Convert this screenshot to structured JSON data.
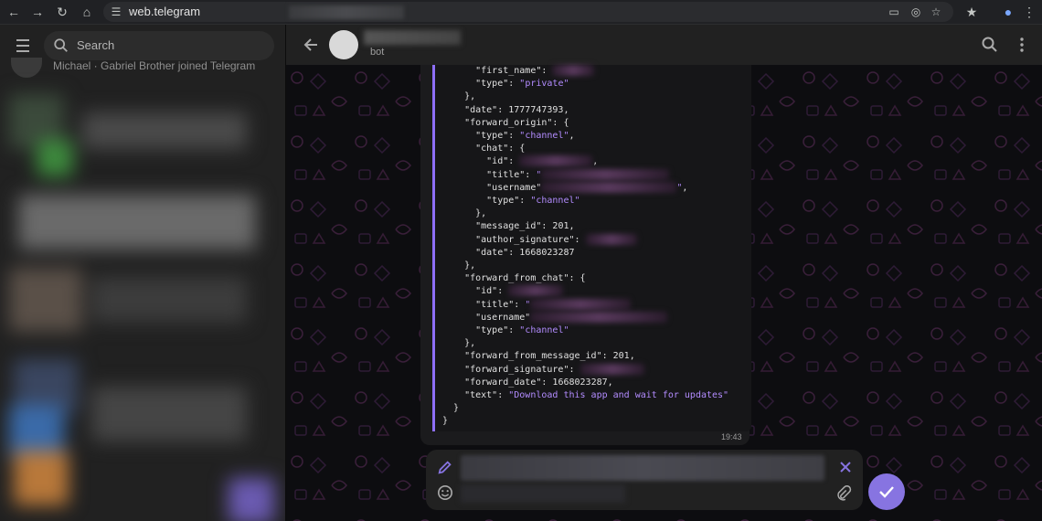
{
  "browser": {
    "url": "web.telegram",
    "nav": [
      "back",
      "forward",
      "reload",
      "home"
    ]
  },
  "sidebar": {
    "search_placeholder": "Search",
    "service_message": "Michael · Gabriel Brother joined Telegram"
  },
  "chat": {
    "subtitle": "bot",
    "time": "19:43"
  },
  "code_lines": [
    [
      {
        "t": "k",
        "v": "      \"first_name\": "
      },
      {
        "t": "r",
        "w": 46
      }
    ],
    [
      {
        "t": "k",
        "v": "      \"type\": "
      },
      {
        "t": "s",
        "v": "\"private\""
      }
    ],
    [
      {
        "t": "k",
        "v": "    },"
      }
    ],
    [
      {
        "t": "k",
        "v": "    \"date\": "
      },
      {
        "t": "n",
        "v": "1777747393"
      },
      {
        "t": "k",
        "v": ","
      }
    ],
    [
      {
        "t": "k",
        "v": "    \"forward_origin\": {"
      }
    ],
    [
      {
        "t": "k",
        "v": "      \"type\": "
      },
      {
        "t": "s",
        "v": "\"channel\""
      },
      {
        "t": "k",
        "v": ","
      }
    ],
    [
      {
        "t": "k",
        "v": "      \"chat\": {"
      }
    ],
    [
      {
        "t": "k",
        "v": "        \"id\": "
      },
      {
        "t": "r",
        "w": 80
      },
      {
        "t": "k",
        "v": ","
      }
    ],
    [
      {
        "t": "k",
        "v": "        \"title\": "
      },
      {
        "t": "s",
        "v": "\""
      },
      {
        "t": "r",
        "w": 140
      }
    ],
    [
      {
        "t": "k",
        "v": "        \"username\""
      },
      {
        "t": "r",
        "w": 148
      },
      {
        "t": "s",
        "v": "\""
      },
      {
        "t": "k",
        "v": ","
      }
    ],
    [
      {
        "t": "k",
        "v": "        \"type\": "
      },
      {
        "t": "s",
        "v": "\"channel\""
      }
    ],
    [
      {
        "t": "k",
        "v": "      },"
      }
    ],
    [
      {
        "t": "k",
        "v": "      \"message_id\": "
      },
      {
        "t": "n",
        "v": "201"
      },
      {
        "t": "k",
        "v": ","
      }
    ],
    [
      {
        "t": "k",
        "v": "      \"author_signature\": "
      },
      {
        "t": "r",
        "w": 56
      }
    ],
    [
      {
        "t": "k",
        "v": "      \"date\": "
      },
      {
        "t": "n",
        "v": "1668023287"
      }
    ],
    [
      {
        "t": "k",
        "v": "    },"
      }
    ],
    [
      {
        "t": "k",
        "v": "    \"forward_from_chat\": {"
      }
    ],
    [
      {
        "t": "k",
        "v": "      \"id\": "
      },
      {
        "t": "r",
        "w": 60
      }
    ],
    [
      {
        "t": "k",
        "v": "      \"title\": "
      },
      {
        "t": "s",
        "v": "\""
      },
      {
        "t": "r",
        "w": 110
      }
    ],
    [
      {
        "t": "k",
        "v": "      \"username\""
      },
      {
        "t": "r",
        "w": 150
      }
    ],
    [
      {
        "t": "k",
        "v": "      \"type\": "
      },
      {
        "t": "s",
        "v": "\"channel\""
      }
    ],
    [
      {
        "t": "k",
        "v": "    },"
      }
    ],
    [
      {
        "t": "k",
        "v": "    \"forward_from_message_id\": "
      },
      {
        "t": "n",
        "v": "201"
      },
      {
        "t": "k",
        "v": ","
      }
    ],
    [
      {
        "t": "k",
        "v": "    \"forward_signature\": "
      },
      {
        "t": "r",
        "w": 70
      }
    ],
    [
      {
        "t": "k",
        "v": "    \"forward_date\": "
      },
      {
        "t": "n",
        "v": "1668023287"
      },
      {
        "t": "k",
        "v": ","
      }
    ],
    [
      {
        "t": "k",
        "v": "    \"text\": "
      },
      {
        "t": "s",
        "v": "\"Download this app and wait for updates\""
      }
    ],
    [
      {
        "t": "k",
        "v": "  }"
      }
    ],
    [
      {
        "t": "k",
        "v": "}"
      }
    ]
  ],
  "colors": {
    "accent": "#8774e1",
    "quote_bar": "#8e6ff7",
    "string": "#b38cff",
    "panel": "#212121"
  },
  "icons": [
    "menu-icon",
    "search-icon",
    "back-arrow-icon",
    "chat-search-icon",
    "more-vertical-icon",
    "edit-pencil-icon",
    "emoji-icon",
    "close-icon",
    "attach-icon",
    "checkmark-icon"
  ]
}
